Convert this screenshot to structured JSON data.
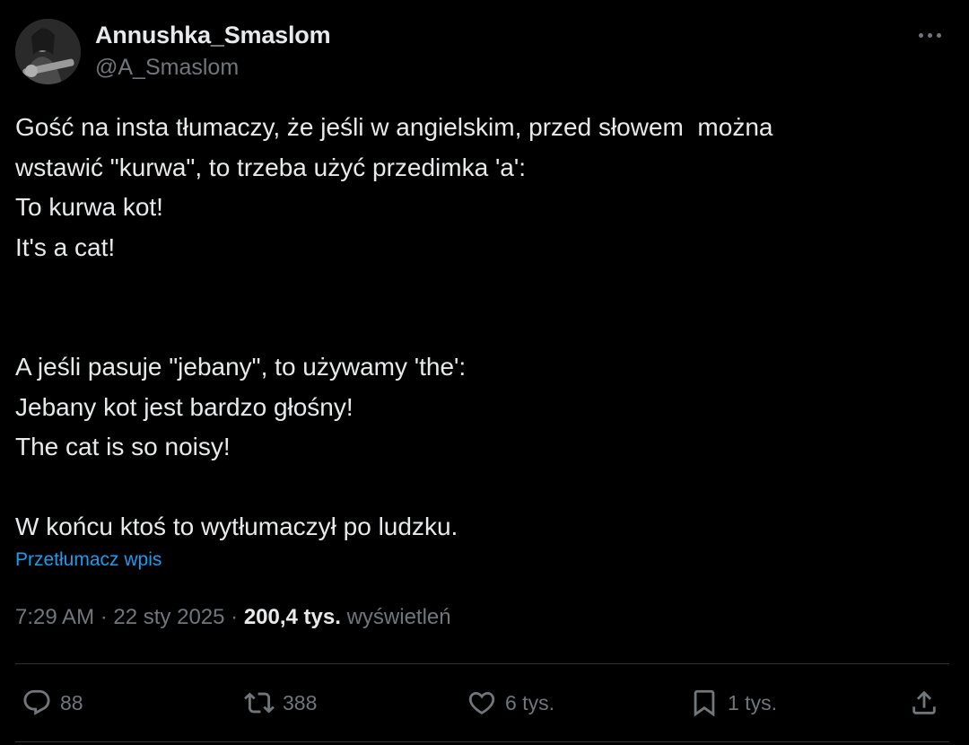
{
  "author": {
    "name": "Annushka_Smaslom",
    "handle": "@A_Smaslom"
  },
  "tweet": {
    "lines": [
      "Gość na insta tłumaczy, że jeśli w angielskim, przed słowem  można",
      "wstawić \"kurwa\", to trzeba użyć przedimka 'a':",
      "To kurwa kot!",
      "It's a cat!",
      "",
      "",
      "A jeśli pasuje \"jebany\", to używamy 'the':",
      "Jebany kot jest bardzo głośny!",
      "The cat is so noisy!",
      "",
      "W końcu ktoś to wytłumaczył po ludzku."
    ],
    "translate_label": "Przetłumacz wpis"
  },
  "meta": {
    "time": "7:29 AM",
    "separator": " · ",
    "date": "22 sty 2025",
    "views_count": "200,4 tys.",
    "views_label": "wyświetleń"
  },
  "actions": {
    "replies": "88",
    "reposts": "388",
    "likes": "6 tys.",
    "bookmarks": "1 tys."
  },
  "icons": {
    "more": "more-dots-icon",
    "reply": "reply-icon",
    "repost": "repost-icon",
    "like": "heart-icon",
    "bookmark": "bookmark-icon",
    "share": "share-icon"
  },
  "colors": {
    "background": "#000000",
    "text": "#e7e9ea",
    "muted": "#71767b",
    "link": "#1d9bf0",
    "divider": "#2f3336"
  }
}
